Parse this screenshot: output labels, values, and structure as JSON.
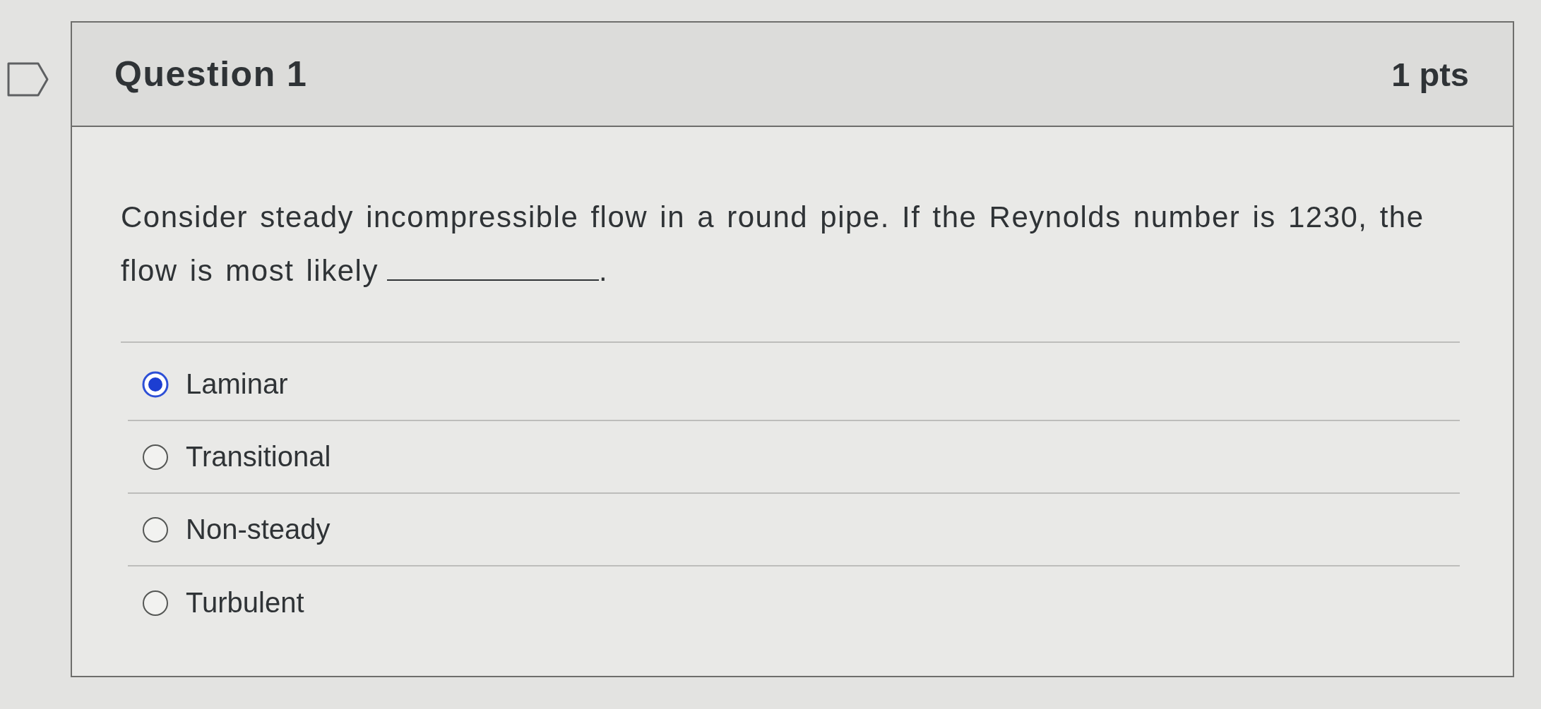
{
  "question": {
    "title": "Question 1",
    "points": "1 pts",
    "text": "Consider steady incompressible flow in a round pipe. If the Reynolds number is 1230, the flow is most likely",
    "text_end": "."
  },
  "answers": [
    {
      "label": "Laminar",
      "selected": true
    },
    {
      "label": "Transitional",
      "selected": false
    },
    {
      "label": "Non-steady",
      "selected": false
    },
    {
      "label": "Turbulent",
      "selected": false
    }
  ]
}
